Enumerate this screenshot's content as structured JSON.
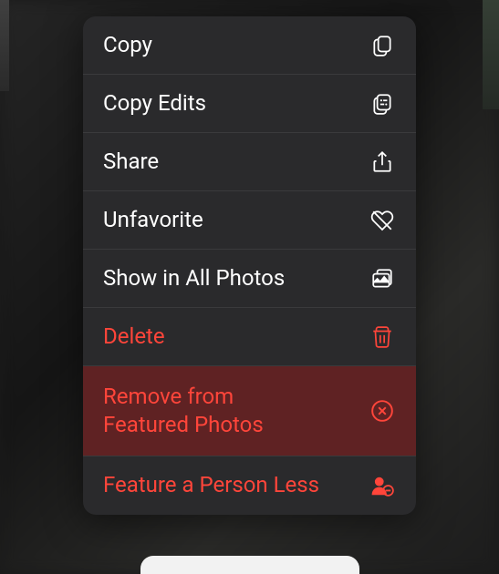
{
  "menu": {
    "items": [
      {
        "label": "Copy",
        "icon": "copy-icon",
        "destructive": false
      },
      {
        "label": "Copy Edits",
        "icon": "copy-edits-icon",
        "destructive": false
      },
      {
        "label": "Share",
        "icon": "share-icon",
        "destructive": false
      },
      {
        "label": "Unfavorite",
        "icon": "heart-slash-icon",
        "destructive": false
      },
      {
        "label": "Show in All Photos",
        "icon": "photo-stack-icon",
        "destructive": false
      },
      {
        "label": "Delete",
        "icon": "trash-icon",
        "destructive": true
      },
      {
        "label": "Remove from\nFeatured Photos",
        "icon": "circle-x-icon",
        "destructive": true,
        "highlighted": true
      },
      {
        "label": "Feature a Person Less",
        "icon": "person-minus-icon",
        "destructive": true
      }
    ]
  },
  "colors": {
    "destructive": "#ff453a",
    "menu_bg": "#2a2a2c",
    "highlight_bg": "#5f2223"
  }
}
